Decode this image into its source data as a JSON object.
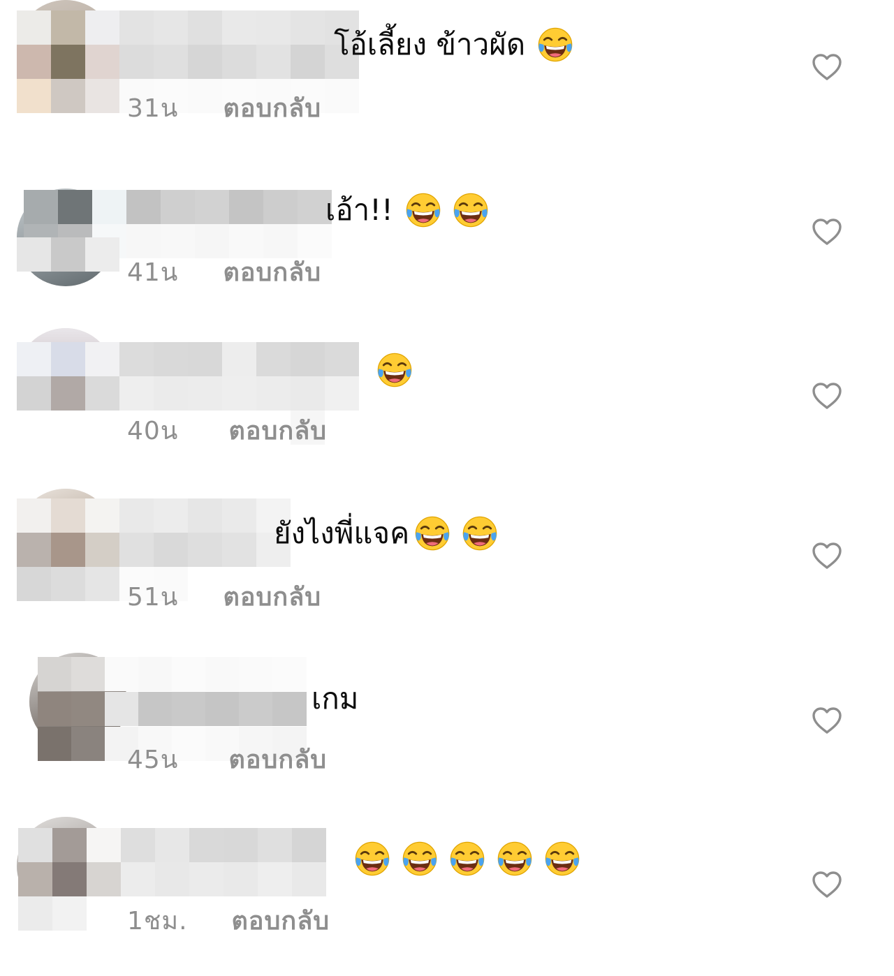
{
  "comments": [
    {
      "text": "โอ้เลี้ยง ข้าวผัด",
      "emoji_count": 1,
      "time": "31น",
      "reply_label": "ตอบกลับ"
    },
    {
      "text": "เอ้า!!",
      "emoji_count": 2,
      "time": "41น",
      "reply_label": "ตอบกลับ"
    },
    {
      "text": "",
      "emoji_count": 1,
      "time": "40น",
      "reply_label": "ตอบกลับ"
    },
    {
      "text": "ยังไงพี่แจค",
      "emoji_count": 2,
      "time": "51น",
      "reply_label": "ตอบกลับ"
    },
    {
      "text": "เกม",
      "emoji_count": 0,
      "time": "45น",
      "reply_label": "ตอบกลับ"
    },
    {
      "text": "",
      "emoji_count": 5,
      "time": "1ชม.",
      "reply_label": "ตอบกลับ"
    }
  ],
  "icons": {
    "like": "heart-outline-icon",
    "emoji": "face-with-tears-of-joy-icon"
  },
  "colors": {
    "meta_text": "#8e8e8e",
    "icon_stroke": "#8e8e8e",
    "emoji_yellow": "#ffcc33"
  }
}
